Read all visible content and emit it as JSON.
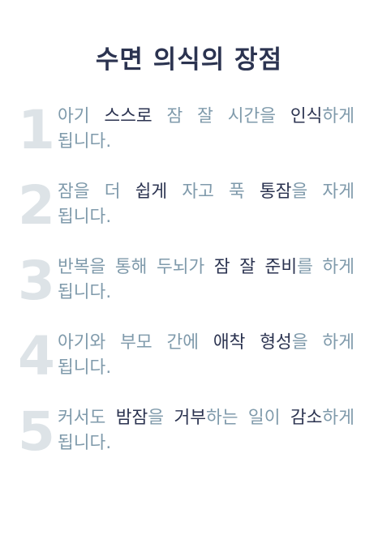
{
  "title": "수면 의식의 장점",
  "items": [
    {
      "number": "1",
      "segments": [
        {
          "text": "아기 ",
          "highlight": false
        },
        {
          "text": "스스로",
          "highlight": true
        },
        {
          "text": " 잠 잘 시간을 ",
          "highlight": false
        },
        {
          "text": "인식",
          "highlight": true
        },
        {
          "text": "하게 됩니다.",
          "highlight": false
        }
      ]
    },
    {
      "number": "2",
      "segments": [
        {
          "text": "잠을 더 ",
          "highlight": false
        },
        {
          "text": "쉽게",
          "highlight": true
        },
        {
          "text": " 자고 푹 ",
          "highlight": false
        },
        {
          "text": "통잠",
          "highlight": true
        },
        {
          "text": "을 자게 됩니다.",
          "highlight": false
        }
      ]
    },
    {
      "number": "3",
      "segments": [
        {
          "text": "반복을 통해 두뇌가 ",
          "highlight": false
        },
        {
          "text": "잠 잘 준비",
          "highlight": true
        },
        {
          "text": "를 하게 됩니다.",
          "highlight": false
        }
      ]
    },
    {
      "number": "4",
      "segments": [
        {
          "text": "아기와 부모 간에 ",
          "highlight": false
        },
        {
          "text": "애착 형성",
          "highlight": true
        },
        {
          "text": "을 하게 됩니다.",
          "highlight": false
        }
      ]
    },
    {
      "number": "5",
      "segments": [
        {
          "text": "커서도 ",
          "highlight": false
        },
        {
          "text": "밤잠",
          "highlight": true
        },
        {
          "text": "을 ",
          "highlight": false
        },
        {
          "text": "거부",
          "highlight": true
        },
        {
          "text": "하는 일이 ",
          "highlight": false
        },
        {
          "text": "감소",
          "highlight": true
        },
        {
          "text": "하게 됩니다.",
          "highlight": false
        }
      ]
    }
  ],
  "colors": {
    "title": "#2b3350",
    "highlight": "#2b3350",
    "body_text": "#7f9aab",
    "number": "#dde3e7",
    "background": "#ffffff"
  }
}
